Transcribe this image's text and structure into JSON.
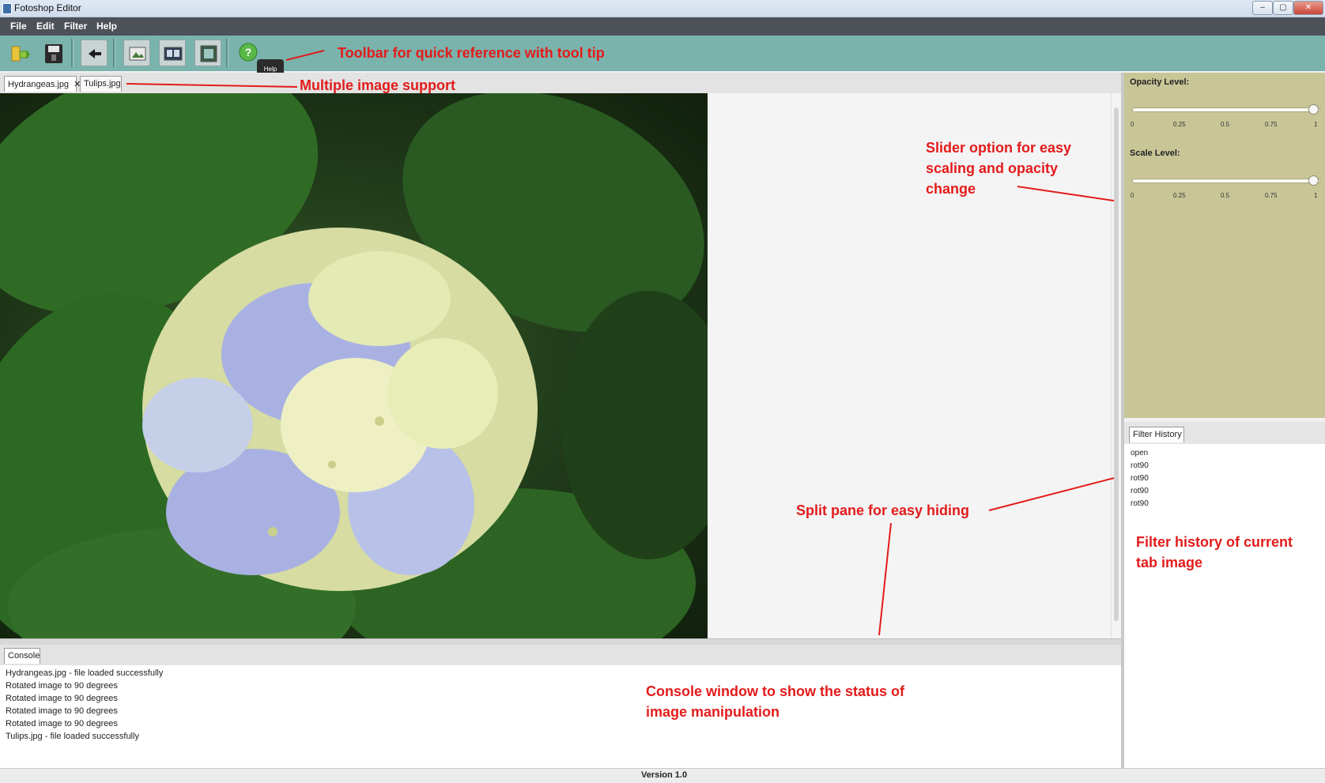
{
  "window": {
    "title": "Fotoshop Editor",
    "controls": [
      "–",
      "▢",
      "✕"
    ]
  },
  "menubar": {
    "items": [
      "File",
      "Edit",
      "Filter",
      "Help"
    ]
  },
  "toolbar": {
    "buttons": [
      "open-folder",
      "save",
      "undo",
      "rotate",
      "flip",
      "resize",
      "help"
    ],
    "tooltip": "Help"
  },
  "tabs": [
    {
      "label": "Hydrangeas.jpg",
      "close": "✕",
      "active": true
    },
    {
      "label": "Tulips.jpg",
      "active": false
    }
  ],
  "console": {
    "tab_label": "Console",
    "lines": [
      "Hydrangeas.jpg - file loaded successfully",
      "Rotated image to 90 degrees",
      "Rotated image to 90 degrees",
      "Rotated image to 90 degrees",
      "Rotated image to 90 degrees",
      "Tulips.jpg - file loaded successfully"
    ]
  },
  "sliders": {
    "opacity": {
      "label": "Opacity Level:",
      "value": 1
    },
    "scale": {
      "label": "Scale Level:",
      "value": 1
    },
    "ticks": [
      "0",
      "0.25",
      "0.5",
      "0.75",
      "1"
    ]
  },
  "filter_history": {
    "tab_label": "Filter History",
    "items": [
      "open",
      "rot90",
      "rot90",
      "rot90",
      "rot90"
    ]
  },
  "status": {
    "version": "Version 1.0"
  },
  "annotations": {
    "toolbar": "Toolbar for quick reference with tool tip",
    "multi_image": "Multiple image support",
    "slider_line1": "Slider option for easy",
    "slider_line2": "scaling and opacity",
    "slider_line3": "change",
    "split_pane": "Split pane for easy hiding",
    "filter_line1": "Filter history of current",
    "filter_line2": "tab image",
    "console_line1": "Console window to show the status of",
    "console_line2": "image manipulation"
  },
  "colors": {
    "toolbar_bg": "#79b3ac",
    "menubar_bg": "#4d5258",
    "slider_panel_bg": "#c8c597",
    "annotation": "#e31b1b"
  }
}
